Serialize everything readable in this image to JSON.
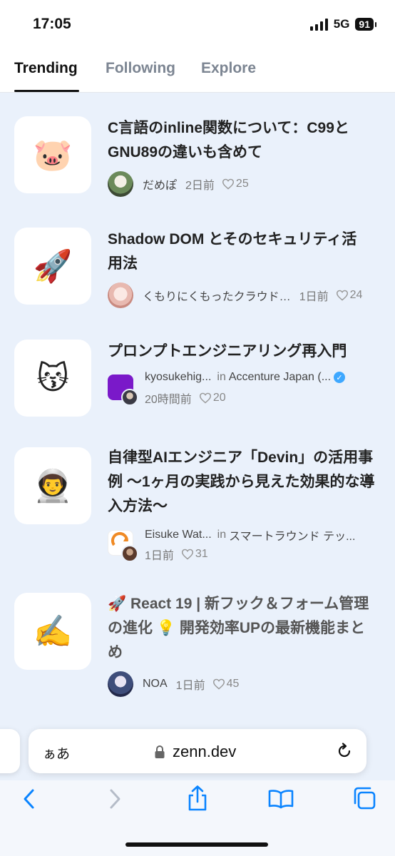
{
  "status": {
    "time": "17:05",
    "network": "5G",
    "battery": "91"
  },
  "tabs": [
    {
      "label": "Trending",
      "active": true
    },
    {
      "label": "Following",
      "active": false
    },
    {
      "label": "Explore",
      "active": false
    }
  ],
  "articles": [
    {
      "emoji": "🐷",
      "title_lines": [
        "C言語のinline関数について：C99と",
        "GNU89の違いも含めて"
      ],
      "author": "だめぽ",
      "date": "2日前",
      "likes": "25"
    },
    {
      "emoji": "🚀",
      "title_lines": [
        "Shadow DOM とそのセキュリティ活",
        "用法"
      ],
      "author": "くもりにくもったクラウド…",
      "date": "1日前",
      "likes": "24"
    },
    {
      "emoji": "😽",
      "title_lines": [
        "プロンプトエンジニアリング再入門"
      ],
      "author": "kyosukehig...",
      "in_word": "in",
      "publication": "Accenture Japan (...",
      "date": "20時間前",
      "likes": "20"
    },
    {
      "emoji": "👨‍🚀",
      "title_lines": [
        "自律型AIエンジニア「Devin」の活用事",
        "例 〜1ヶ月の実践から見えた効果的な導",
        "入方法〜"
      ],
      "author": "Eisuke Wat...",
      "in_word": "in",
      "publication": "スマートラウンド テッ...",
      "date": "1日前",
      "likes": "31"
    },
    {
      "emoji": "✍️",
      "title_lines": [
        "🚀 React 19 | 新フック＆フォーム管理",
        "の進化 💡 開発効率UPの最新機能まと",
        "め"
      ],
      "author": "NOA",
      "date": "1日前",
      "likes": "45"
    }
  ],
  "browser": {
    "text_size_label": "ぁあ",
    "url": "zenn.dev"
  },
  "colors": {
    "accent": "#3ea8ff",
    "feed_bg": "#eaf1fb",
    "ios_blue": "#0a84ff"
  }
}
